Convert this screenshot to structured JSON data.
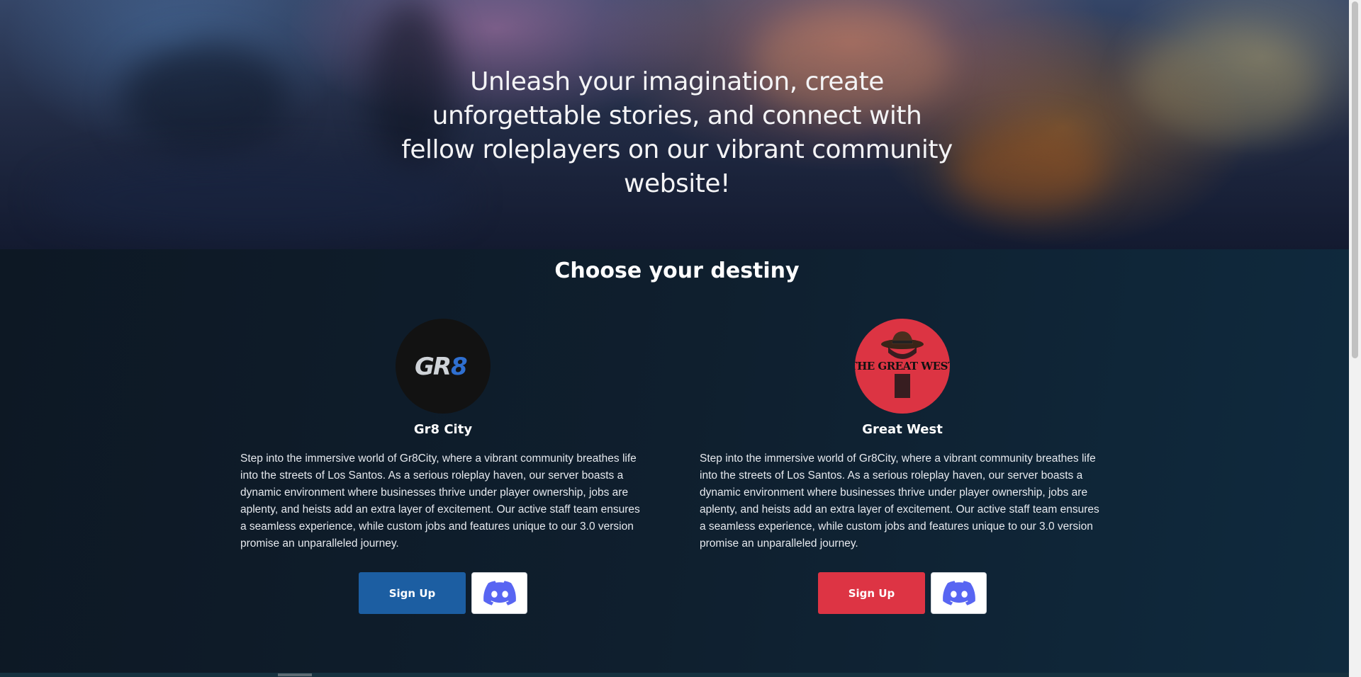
{
  "hero": {
    "tagline": "Unleash your imagination, create unforgettable stories, and connect with fellow roleplayers on our vibrant community website!"
  },
  "section": {
    "title": "Choose your destiny"
  },
  "servers": [
    {
      "name": "Gr8 City",
      "logo_text": "GR8",
      "description": "Step into the immersive world of Gr8City, where a vibrant community breathes life into the streets of Los Santos. As a serious roleplay haven, our server boasts a dynamic environment where businesses thrive under player ownership, jobs are aplenty, and heists add an extra layer of excitement. Our active staff team ensures a seamless experience, while custom jobs and features unique to our 3.0 version promise an unparalleled journey.",
      "signup_label": "Sign Up",
      "accent_color": "#1c5ea2",
      "discord_icon": "discord-icon"
    },
    {
      "name": "Great West",
      "logo_text": "THE GREAT WEST",
      "description": "Step into the immersive world of Gr8City, where a vibrant community breathes life into the streets of Los Santos. As a serious roleplay haven, our server boasts a dynamic environment where businesses thrive under player ownership, jobs are aplenty, and heists add an extra layer of excitement. Our active staff team ensures a seamless experience, while custom jobs and features unique to our 3.0 version promise an unparalleled journey.",
      "signup_label": "Sign Up",
      "accent_color": "#dd3444",
      "discord_icon": "discord-icon"
    }
  ],
  "colors": {
    "discord": "#5865f2",
    "background": "#0e1e2c"
  }
}
